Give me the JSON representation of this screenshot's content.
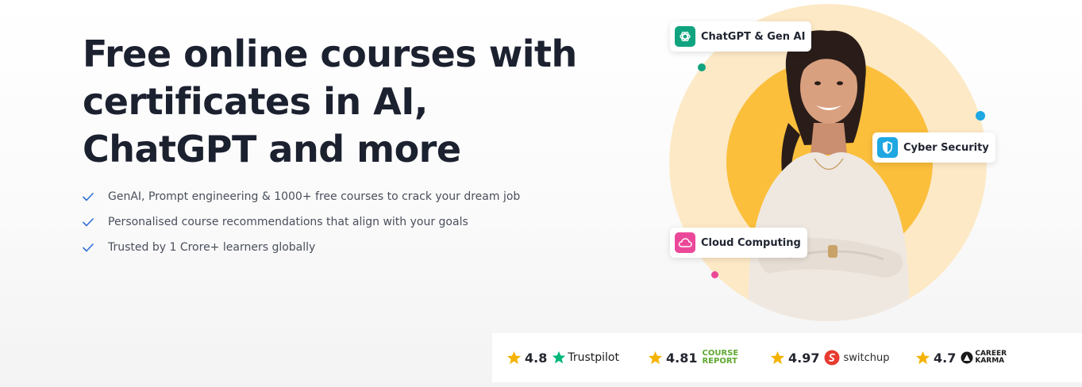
{
  "hero": {
    "title_lines": [
      "Free online courses with",
      "certificates in AI,",
      "ChatGPT and more"
    ],
    "features": [
      "GenAI, Prompt engineering & 1000+ free courses to crack your dream job",
      "Personalised course recommendations that align with your goals",
      "Trusted by 1 Crore+ learners globally"
    ]
  },
  "chips": [
    {
      "label": "ChatGPT & Gen AI",
      "icon": "openai-icon",
      "color": "#10a37f"
    },
    {
      "label": "Cyber Security",
      "icon": "shield-icon",
      "color": "#1ea7e1"
    },
    {
      "label": "Cloud Computing",
      "icon": "cloud-icon",
      "color": "#ec4899"
    }
  ],
  "ratings": [
    {
      "value": "4.8",
      "brand": "Trustpilot"
    },
    {
      "value": "4.81",
      "brand_lines": [
        "COURSE",
        "REPORT"
      ]
    },
    {
      "value": "4.97",
      "brand": "switchup"
    },
    {
      "value": "4.7",
      "brand_lines": [
        "CAREER",
        "KARMA"
      ]
    }
  ],
  "colors": {
    "title": "#1c2130",
    "check": "#2f6fd6",
    "star": "#f5b301",
    "trustpilot_green": "#00b67a",
    "course_report_green": "#5fa832",
    "switchup_red": "#e83a2f",
    "halo_light": "#fde9c6",
    "halo_dark": "#fbbf3c"
  }
}
